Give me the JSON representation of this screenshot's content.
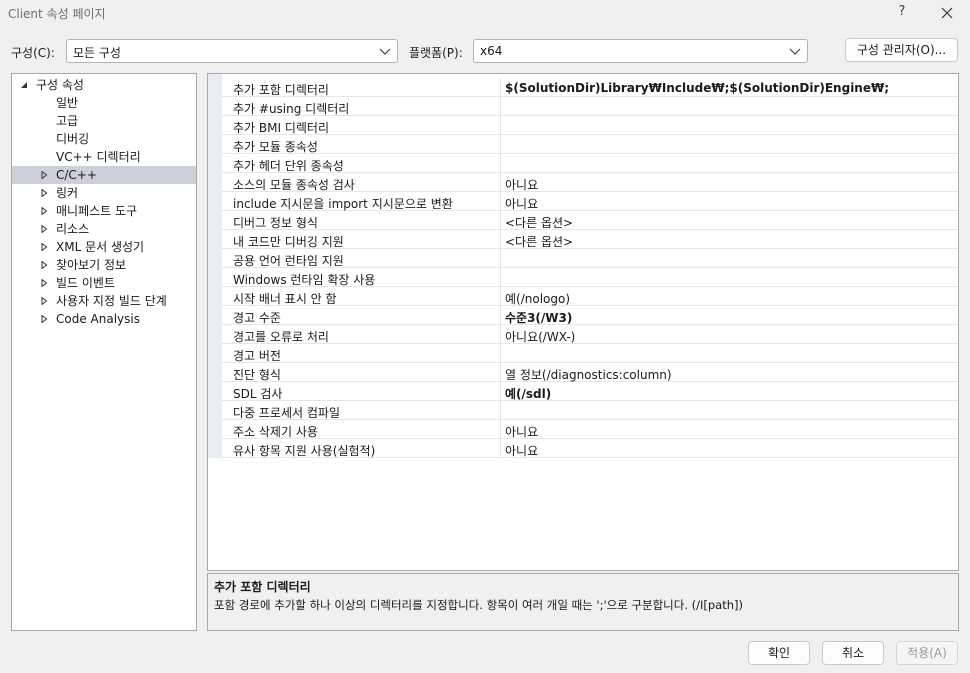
{
  "window": {
    "title": "Client 속성 페이지",
    "help_label": "?"
  },
  "config": {
    "config_label": "구성(C):",
    "config_value": "모든 구성",
    "platform_label": "플랫폼(P):",
    "platform_value": "x64",
    "manager_button": "구성 관리자(O)..."
  },
  "tree": {
    "items": [
      {
        "label": "구성 속성",
        "level": 0,
        "expanded": true
      },
      {
        "label": "일반",
        "level": 2
      },
      {
        "label": "고급",
        "level": 2
      },
      {
        "label": "디버깅",
        "level": 2
      },
      {
        "label": "VC++ 디렉터리",
        "level": 2
      },
      {
        "label": "C/C++",
        "level": 1,
        "selected": true
      },
      {
        "label": "링커",
        "level": 1
      },
      {
        "label": "매니페스트 도구",
        "level": 1
      },
      {
        "label": "리소스",
        "level": 1
      },
      {
        "label": "XML 문서 생성기",
        "level": 1
      },
      {
        "label": "찾아보기 정보",
        "level": 1
      },
      {
        "label": "빌드 이벤트",
        "level": 1
      },
      {
        "label": "사용자 지정 빌드 단계",
        "level": 1
      },
      {
        "label": "Code Analysis",
        "level": 1
      }
    ]
  },
  "properties": [
    {
      "name": "추가 포함 디렉터리",
      "value": "$(SolutionDir)Library₩Include₩;$(SolutionDir)Engine₩;",
      "bold": true
    },
    {
      "name": "추가 #using 디렉터리",
      "value": ""
    },
    {
      "name": "추가 BMI 디렉터리",
      "value": ""
    },
    {
      "name": "추가 모듈 종속성",
      "value": ""
    },
    {
      "name": "추가 헤더 단위 종속성",
      "value": ""
    },
    {
      "name": "소스의 모듈 종속성 검사",
      "value": "아니요"
    },
    {
      "name": "include 지시문을 import 지시문으로 변환",
      "value": "아니요"
    },
    {
      "name": "디버그 정보 형식",
      "value": "<다른 옵션>"
    },
    {
      "name": "내 코드만 디버깅 지원",
      "value": "<다른 옵션>"
    },
    {
      "name": "공용 언어 런타임 지원",
      "value": ""
    },
    {
      "name": "Windows 런타임 확장 사용",
      "value": ""
    },
    {
      "name": "시작 배너 표시 안 함",
      "value": "예(/nologo)"
    },
    {
      "name": "경고 수준",
      "value": "수준3(/W3)",
      "bold": true
    },
    {
      "name": "경고를 오류로 처리",
      "value": "아니요(/WX-)"
    },
    {
      "name": "경고 버전",
      "value": ""
    },
    {
      "name": "진단 형식",
      "value": "열 정보(/diagnostics:column)"
    },
    {
      "name": "SDL 검사",
      "value": "예(/sdl)",
      "bold": true
    },
    {
      "name": "다중 프로세서 컴파일",
      "value": ""
    },
    {
      "name": "주소 삭제기 사용",
      "value": "아니요"
    },
    {
      "name": "유사 항목 지원 사용(실험적)",
      "value": "아니요"
    }
  ],
  "description": {
    "title": "추가 포함 디렉터리",
    "text": "포함 경로에 추가할 하나 이상의 디렉터리를 지정합니다. 항목이 여러 개일 때는 ';'으로 구분합니다. (/I[path])"
  },
  "buttons": {
    "ok": "확인",
    "cancel": "취소",
    "apply": "적용(A)"
  },
  "colors": {
    "selection": "#cdd0d8",
    "gutter": "#e9edf3"
  }
}
